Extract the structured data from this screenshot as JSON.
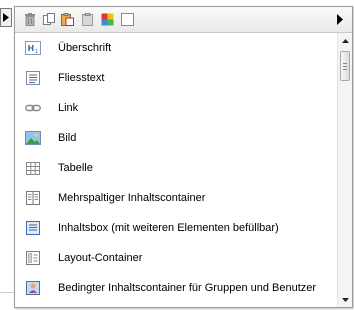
{
  "toolbar": {
    "icons": [
      "trash-icon",
      "copy-icon",
      "paste-icon",
      "clipboard-icon",
      "color-palette-icon",
      "blank-square-icon"
    ],
    "more_icon": "arrow-right-icon"
  },
  "items": [
    {
      "label": "Überschrift",
      "icon": "heading-icon"
    },
    {
      "label": "Fliesstext",
      "icon": "paragraph-icon"
    },
    {
      "label": "Link",
      "icon": "link-icon"
    },
    {
      "label": "Bild",
      "icon": "image-icon"
    },
    {
      "label": "Tabelle",
      "icon": "table-icon"
    },
    {
      "label": "Mehrspaltiger Inhaltscontainer",
      "icon": "columns-icon"
    },
    {
      "label": "Inhaltsbox (mit weiteren Elementen befüllbar)",
      "icon": "content-box-icon"
    },
    {
      "label": "Layout-Container",
      "icon": "layout-container-icon"
    },
    {
      "label": "Bedingter Inhaltscontainer für Gruppen und Benutzer",
      "icon": "user-group-container-icon"
    }
  ],
  "colors": {
    "border": "#9a9a9a",
    "icon_blue": "#3a6fb5",
    "icon_grey": "#7d7d7d"
  }
}
